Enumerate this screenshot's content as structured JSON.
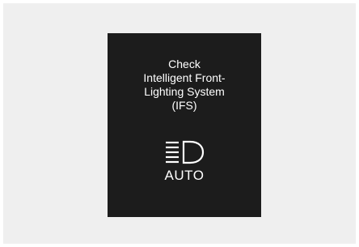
{
  "warning": {
    "lines": [
      "Check",
      "Intelligent Front-",
      "Lighting System",
      "(IFS)"
    ],
    "icon": "auto-headlight-icon",
    "indicator_label": "AUTO"
  },
  "colors": {
    "background": "#efefef",
    "display": "#1c1c1c",
    "text": "#ffffff"
  }
}
